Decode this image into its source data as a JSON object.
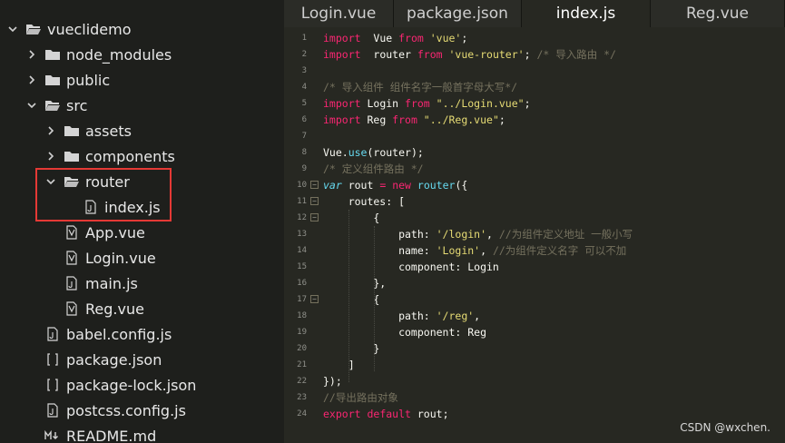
{
  "sidebar": {
    "items": [
      {
        "label": "vueclidemo",
        "kind": "folder-open",
        "depth": 0
      },
      {
        "label": "node_modules",
        "kind": "folder",
        "depth": 1
      },
      {
        "label": "public",
        "kind": "folder",
        "depth": 1
      },
      {
        "label": "src",
        "kind": "folder-open",
        "depth": 1
      },
      {
        "label": "assets",
        "kind": "folder",
        "depth": 2
      },
      {
        "label": "components",
        "kind": "folder",
        "depth": 2
      },
      {
        "label": "router",
        "kind": "folder-open",
        "depth": 2
      },
      {
        "label": "index.js",
        "kind": "file-js",
        "depth": 3
      },
      {
        "label": "App.vue",
        "kind": "file-vue",
        "depth": 2
      },
      {
        "label": "Login.vue",
        "kind": "file-vue",
        "depth": 2
      },
      {
        "label": "main.js",
        "kind": "file-js",
        "depth": 2
      },
      {
        "label": "Reg.vue",
        "kind": "file-vue",
        "depth": 2
      },
      {
        "label": "babel.config.js",
        "kind": "file-js",
        "depth": 1
      },
      {
        "label": "package.json",
        "kind": "file-json",
        "depth": 1
      },
      {
        "label": "package-lock.json",
        "kind": "file-json",
        "depth": 1
      },
      {
        "label": "postcss.config.js",
        "kind": "file-js",
        "depth": 1
      },
      {
        "label": "README.md",
        "kind": "file-md",
        "depth": 1
      }
    ]
  },
  "tabs": [
    {
      "label": "Login.vue",
      "active": false
    },
    {
      "label": "package.json",
      "active": false
    },
    {
      "label": "index.js",
      "active": true
    },
    {
      "label": "Reg.vue",
      "active": false
    }
  ],
  "editor": {
    "lines": [
      {
        "n": "1",
        "parts": [
          [
            "kw",
            "import"
          ],
          [
            "",
            "  Vue "
          ],
          [
            "kw",
            "from"
          ],
          [
            "str",
            " 'vue'"
          ],
          [
            "",
            ";"
          ]
        ]
      },
      {
        "n": "2",
        "parts": [
          [
            "kw",
            "import"
          ],
          [
            "",
            "  router "
          ],
          [
            "kw",
            "from"
          ],
          [
            "str",
            " 'vue-router'"
          ],
          [
            "",
            "; "
          ],
          [
            "cm",
            "/* 导入路由 */"
          ]
        ]
      },
      {
        "n": "3",
        "parts": []
      },
      {
        "n": "4",
        "parts": [
          [
            "cm",
            "/* 导入组件 组件名字一般首字母大写*/"
          ]
        ]
      },
      {
        "n": "5",
        "parts": [
          [
            "kw",
            "import"
          ],
          [
            "",
            " Login "
          ],
          [
            "kw",
            "from"
          ],
          [
            "str",
            " \"../Login.vue\""
          ],
          [
            "",
            ";"
          ]
        ]
      },
      {
        "n": "6",
        "parts": [
          [
            "kw",
            "import"
          ],
          [
            "",
            " Reg "
          ],
          [
            "kw",
            "from"
          ],
          [
            "str",
            " \"../Reg.vue\""
          ],
          [
            "",
            ";"
          ]
        ]
      },
      {
        "n": "7",
        "parts": []
      },
      {
        "n": "8",
        "parts": [
          [
            "",
            "Vue."
          ],
          [
            "fn",
            "use"
          ],
          [
            "",
            "(router);"
          ]
        ]
      },
      {
        "n": "9",
        "parts": [
          [
            "cm",
            "/* 定义组件路由 */"
          ]
        ]
      },
      {
        "n": "10",
        "fold": true,
        "parts": [
          [
            "var",
            "var"
          ],
          [
            "",
            " rout "
          ],
          [
            "kw",
            "="
          ],
          [
            "",
            " "
          ],
          [
            "kw",
            "new"
          ],
          [
            "",
            " "
          ],
          [
            "fn",
            "router"
          ],
          [
            "",
            "({"
          ]
        ]
      },
      {
        "n": "11",
        "fold": true,
        "parts": [
          [
            "",
            "    routes: ["
          ]
        ]
      },
      {
        "n": "12",
        "fold": true,
        "parts": [
          [
            "",
            "        {"
          ]
        ]
      },
      {
        "n": "13",
        "parts": [
          [
            "",
            "            path: "
          ],
          [
            "str",
            "'/login'"
          ],
          [
            "",
            ", "
          ],
          [
            "cm",
            "//为组件定义地址 一般小写"
          ]
        ]
      },
      {
        "n": "14",
        "parts": [
          [
            "",
            "            name: "
          ],
          [
            "str",
            "'Login'"
          ],
          [
            "",
            ", "
          ],
          [
            "cm",
            "//为组件定义名字 可以不加"
          ]
        ]
      },
      {
        "n": "15",
        "parts": [
          [
            "",
            "            component: Login"
          ]
        ]
      },
      {
        "n": "16",
        "parts": [
          [
            "",
            "        },"
          ]
        ]
      },
      {
        "n": "17",
        "fold": true,
        "parts": [
          [
            "",
            "        {"
          ]
        ]
      },
      {
        "n": "18",
        "parts": [
          [
            "",
            "            path: "
          ],
          [
            "str",
            "'/reg'"
          ],
          [
            "",
            ","
          ]
        ]
      },
      {
        "n": "19",
        "parts": [
          [
            "",
            "            component: Reg"
          ]
        ]
      },
      {
        "n": "20",
        "parts": [
          [
            "",
            "        }"
          ]
        ]
      },
      {
        "n": "21",
        "parts": [
          [
            "",
            "    ]"
          ]
        ]
      },
      {
        "n": "22",
        "parts": [
          [
            "",
            "});"
          ]
        ]
      },
      {
        "n": "23",
        "parts": [
          [
            "cm",
            "//导出路由对象"
          ]
        ]
      },
      {
        "n": "24",
        "parts": [
          [
            "kw",
            "export"
          ],
          [
            "",
            " "
          ],
          [
            "kw",
            "default"
          ],
          [
            "",
            " rout;"
          ]
        ]
      }
    ]
  },
  "watermark": "CSDN @wxchen."
}
